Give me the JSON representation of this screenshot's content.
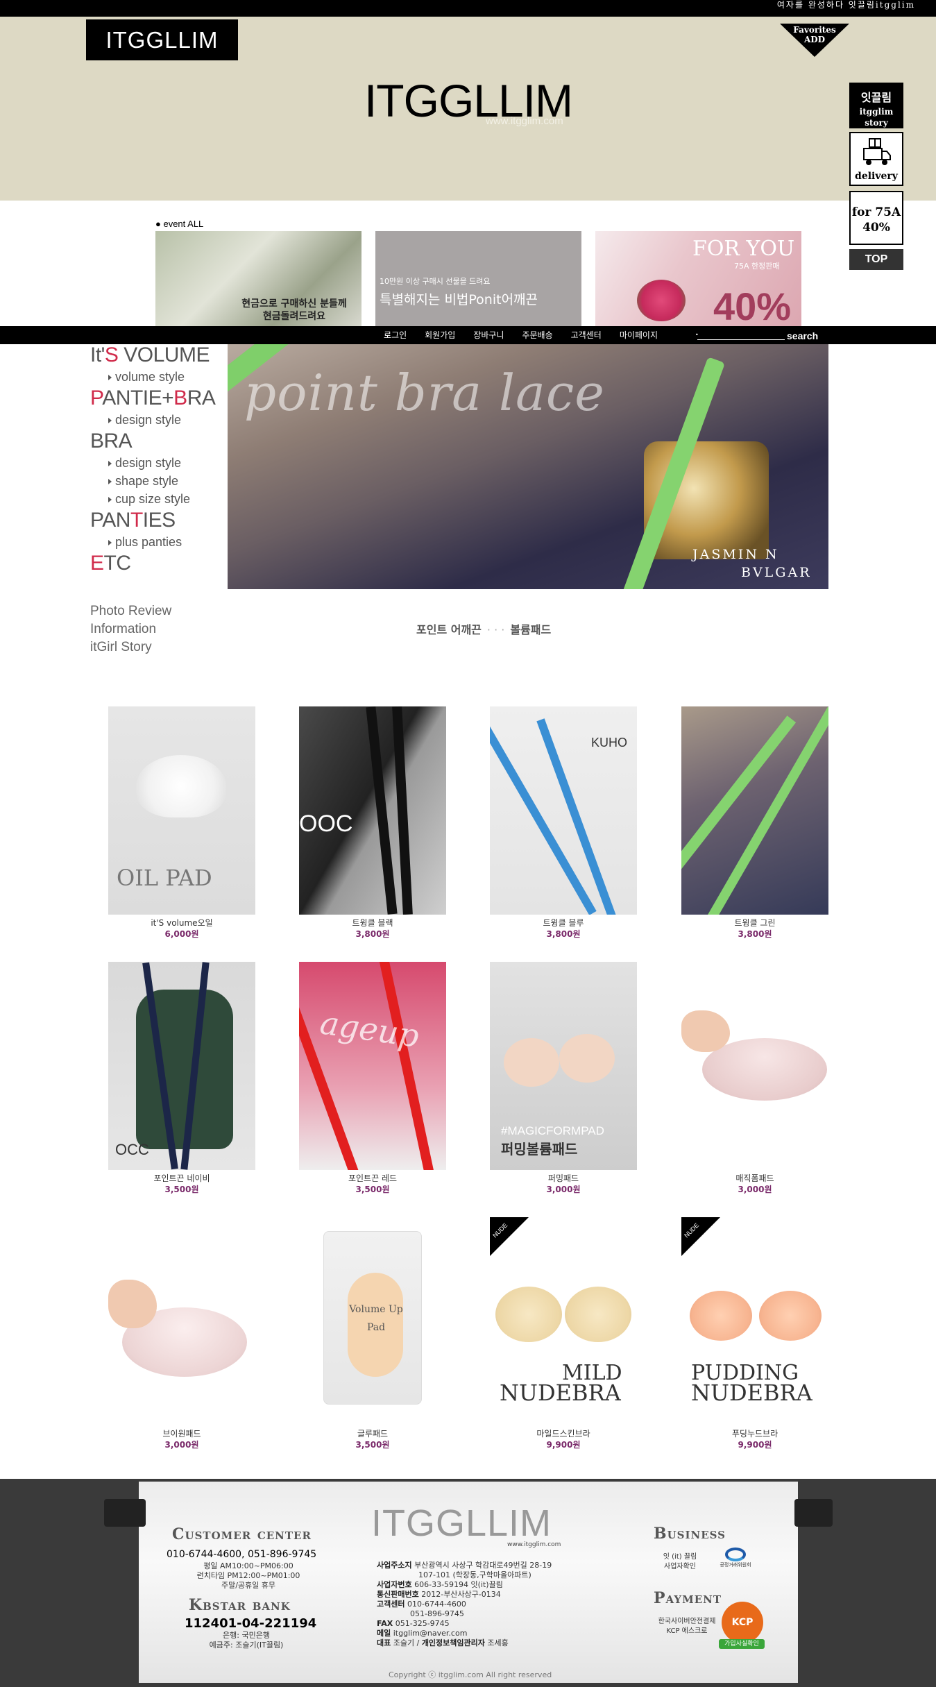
{
  "topbar": {
    "links": "여자를 완성하다 잇끌림itgglim"
  },
  "header": {
    "logo_small": "ITGGLLIM",
    "logo_big": "ITGGLLIM",
    "logo_url": "www.itgglim.com",
    "favorites": "Favorites\nADD"
  },
  "quick": {
    "story_line1": "잇끌림",
    "story_line2": "itgglim story",
    "delivery": "delivery",
    "for75a_line1": "for 75A",
    "for75a_line2": "40%",
    "top": "TOP"
  },
  "event": {
    "title": "● event ALL",
    "banners": [
      {
        "line1": "현금으로 구매하신 분들께",
        "line2": "현금돌려드려요"
      },
      {
        "line1": "10만원 이상 구매시 선물을 드려요",
        "line2": "특별해지는 비법Ponit어깨끈"
      },
      {
        "line1": "FOR YOU",
        "line2": "75A 한정판매",
        "line3": "40%"
      }
    ]
  },
  "nav": {
    "items": [
      "로그인",
      "회원가입",
      "장바구니",
      "주문배송",
      "고객센터",
      "마이페이지"
    ],
    "search_dot": "•",
    "search_label": "search",
    "search_value": ""
  },
  "side": {
    "cat1_pre": "It'",
    "cat1_red": "S",
    "cat1_post": " VOLUME",
    "cat1_sub": [
      "volume style"
    ],
    "cat2_red1": "P",
    "cat2_mid": "ANTIE+",
    "cat2_red2": "B",
    "cat2_post": "RA",
    "cat2_sub": [
      "design style"
    ],
    "cat3": "BRA",
    "cat3_sub": [
      "design style",
      "shape style",
      "cup size style"
    ],
    "cat4_pre": "PAN",
    "cat4_red": "T",
    "cat4_post": "IES",
    "cat4_sub": [
      "plus panties"
    ],
    "cat5_red": "E",
    "cat5_post": "TC",
    "links": [
      "Photo Review",
      "Information",
      "itGirl Story"
    ]
  },
  "banner": {
    "script_text": "point bra lace",
    "brand_line1": "JASMIN N",
    "brand_line2": "BVLGAR"
  },
  "subcats": {
    "first": "포인트 어깨끈",
    "dots": "·  ·  ·",
    "second": "볼륨패드"
  },
  "products": [
    {
      "name": "it'S volume오일",
      "price": "6,000원",
      "img_text": "OIL PAD"
    },
    {
      "name": "트윙클 블랙",
      "price": "3,800원",
      "img_text": "OOC"
    },
    {
      "name": "트윙클 블루",
      "price": "3,800원",
      "img_text": "KUHO"
    },
    {
      "name": "트윙클 그린",
      "price": "3,800원",
      "img_text": ""
    },
    {
      "name": "포인트끈 네이비",
      "price": "3,500원",
      "img_text": "OCC"
    },
    {
      "name": "포인트끈 레드",
      "price": "3,500원",
      "img_text": "ageup"
    },
    {
      "name": "퍼밍패드",
      "price": "3,000원",
      "img_text": "#MAGICFORMPAD",
      "img_text2": "퍼밍볼륨패드"
    },
    {
      "name": "매직폼패드",
      "price": "3,000원",
      "img_text": ""
    },
    {
      "name": "브이원패드",
      "price": "3,000원",
      "img_text": ""
    },
    {
      "name": "글루패드",
      "price": "3,500원",
      "img_text": "Volume Up Pad"
    },
    {
      "name": "마일드스킨브라",
      "price": "9,900원",
      "img_text": "MILD",
      "img_text2": "NUDEBRA",
      "badge": "NUDE"
    },
    {
      "name": "푸딩누드브라",
      "price": "9,900원",
      "img_text": "PUDDING",
      "img_text2": "NUDEBRA",
      "badge": "NUDE"
    }
  ],
  "footer": {
    "logo": "ITGGLLIM",
    "logo_url": "www.itgglim.com",
    "cs_title": "Customer center",
    "cs_phone": "010-6744-4600, 051-896-9745",
    "cs_hours": [
      "평일 AM10:00~PM06:00",
      "런치타임 PM12:00~PM01:00",
      "주말/공휴일 휴무"
    ],
    "bank_title": "Kbstar bank",
    "bank_account": "112401-04-221194",
    "bank_name": "은행: 국민은행",
    "bank_holder": "예금주: 조슬기(IT끌림)",
    "info": [
      {
        "k": "사업주소지",
        "v": "부산광역시 사상구 학감대로49번길 28-19"
      },
      {
        "k": "",
        "v": "107-101 (학장동,구학마을아파트)"
      },
      {
        "k": "사업자번호",
        "v": "606-33-59194 잇(it)끌림"
      },
      {
        "k": "통신판매번호",
        "v": "2012-부산사상구-0134"
      },
      {
        "k": "고객센터",
        "v": "010-6744-4600"
      },
      {
        "k": "",
        "v": "051-896-9745"
      },
      {
        "k": "FAX",
        "v": "051-325-9745"
      },
      {
        "k": "메일",
        "v": "itgglim@naver.com"
      },
      {
        "k": "대표",
        "v": "조슬기 / "
      }
    ],
    "privacy_k": "개인정보책임관리자",
    "privacy_v": "조세홍",
    "business_title": "Business",
    "business_lines": [
      "잇 (it) 끌림",
      "사업자확인"
    ],
    "ftc_label": "공정거래위원회",
    "payment_title": "Payment",
    "payment_lines": [
      "한국사이버안전결제",
      "KCP 에스크로"
    ],
    "kcp_label": "KCP",
    "kcp_badge": "가입사실확인",
    "copyright": "Copyright ⓒ itgglim.com All right reserved"
  }
}
